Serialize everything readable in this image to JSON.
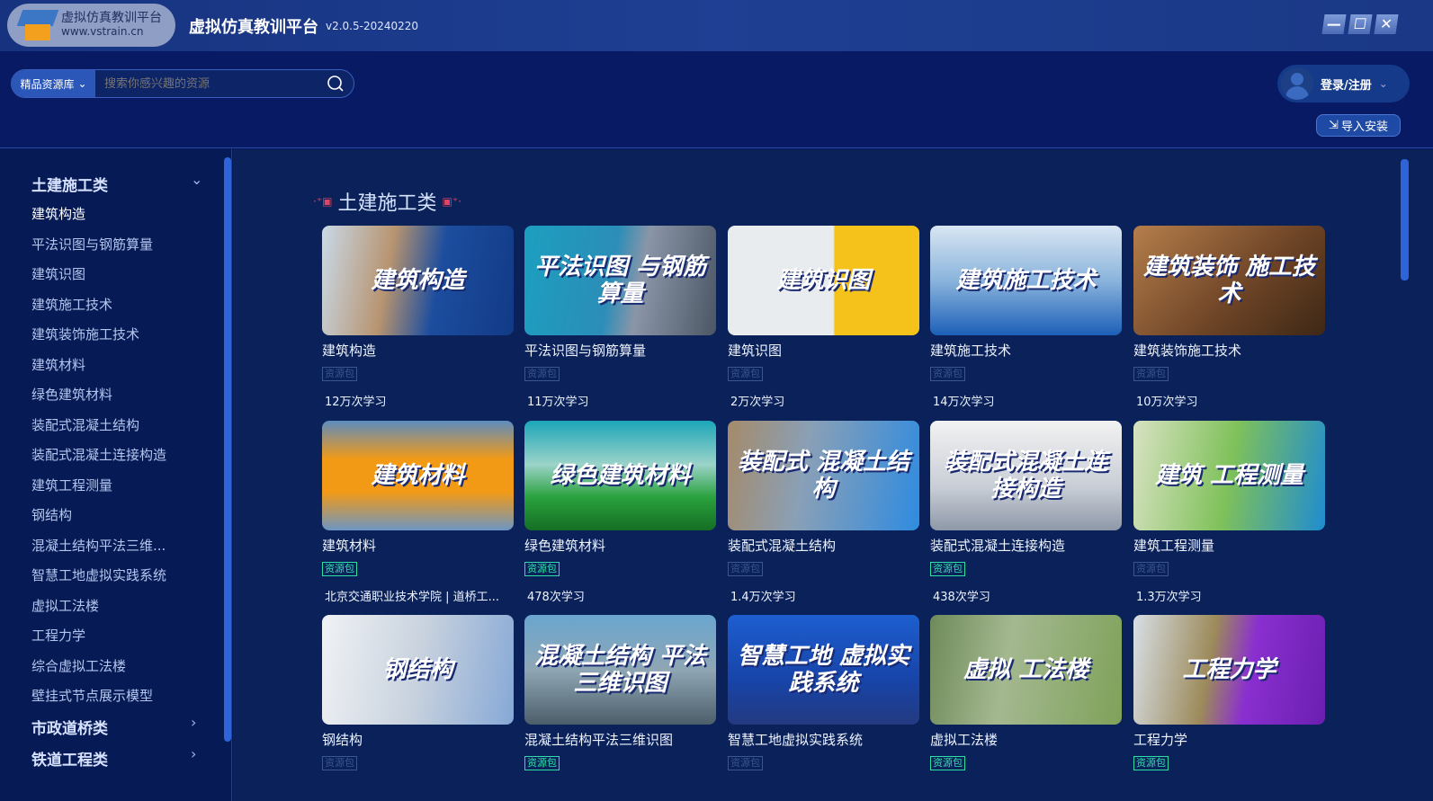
{
  "app": {
    "logo_text": "虚拟仿真教训平台",
    "logo_url": "www.vstrain.cn",
    "title": "虚拟仿真教训平台",
    "version": "v2.0.5-20240220"
  },
  "window": {
    "minimize": "—",
    "maximize": "☐",
    "close": "✕"
  },
  "search": {
    "scope": "精品资源库",
    "placeholder": "搜索你感兴趣的资源"
  },
  "user": {
    "login_label": "登录/注册",
    "import_label": "导入安装"
  },
  "sidebar": {
    "categories": [
      {
        "label": "土建施工类",
        "expanded": true
      },
      {
        "label": "市政道桥类"
      },
      {
        "label": "铁道工程类"
      }
    ],
    "items": [
      "建筑构造",
      "平法识图与钢筋算量",
      "建筑识图",
      "建筑施工技术",
      "建筑装饰施工技术",
      "建筑材料",
      "绿色建筑材料",
      "装配式混凝土结构",
      "装配式混凝土连接构造",
      "建筑工程测量",
      "钢结构",
      "混凝土结构平法三维...",
      "智慧工地虚拟实践系统",
      "虚拟工法楼",
      "工程力学",
      "综合虚拟工法楼",
      "壁挂式节点展示模型"
    ],
    "active_index": 0
  },
  "section": {
    "title": "土建施工类"
  },
  "cards": [
    {
      "name": "建筑构造",
      "thumb": "建筑构造",
      "badge": "资源包",
      "badge_active": false,
      "stat": "12万次学习",
      "bg": "linear-gradient(100deg,#c9d9e8,#b79470 35%,#1c4d9e 60%,#123a86)"
    },
    {
      "name": "平法识图与钢筋算量",
      "thumb": "平法识图 与钢筋算量",
      "badge": "资源包",
      "badge_active": false,
      "stat": "11万次学习",
      "bg": "linear-gradient(100deg,#1c9fc0,#2b8db8 45%,#8a96a8 60%,#4b5664)"
    },
    {
      "name": "建筑识图",
      "thumb": "建筑识图",
      "badge": "资源包",
      "badge_active": false,
      "stat": "2万次学习",
      "bg": "linear-gradient(90deg,#e9ecef 55%,#f5c21b 56%)"
    },
    {
      "name": "建筑施工技术",
      "thumb": "建筑施工技术",
      "badge": "资源包",
      "badge_active": false,
      "stat": "14万次学习",
      "bg": "linear-gradient(180deg,#d9e6f3,#8ab4dc 50%,#1d5fb8)"
    },
    {
      "name": "建筑装饰施工技术",
      "thumb": "建筑装饰 施工技术",
      "badge": "资源包",
      "badge_active": false,
      "stat": "10万次学习",
      "bg": "linear-gradient(135deg,#b57e4b,#6b4225 60%,#3d2816)"
    },
    {
      "name": "建筑材料",
      "thumb": "建筑材料",
      "badge": "资源包",
      "badge_active": true,
      "stat": "北京交通职业技术学院 | 道桥工...",
      "bg": "linear-gradient(180deg,#5d8cc0,#f29a16 35%,#f29a16 65%,#6c96c4)"
    },
    {
      "name": "绿色建筑材料",
      "thumb": "绿色建筑材料",
      "badge": "资源包",
      "badge_active": true,
      "stat": "478次学习",
      "bg": "linear-gradient(180deg,#1ca6b8,#9bd3c8 40%,#29a13d 70%,#156e24)"
    },
    {
      "name": "装配式混凝土结构",
      "thumb": "装配式 混凝土结构",
      "badge": "资源包",
      "badge_active": false,
      "stat": "1.4万次学习",
      "bg": "linear-gradient(100deg,#a58a6a,#8aa0b6 40%,#2f8be0)"
    },
    {
      "name": "装配式混凝土连接构造",
      "thumb": "装配式混凝土连接构造",
      "badge": "资源包",
      "badge_active": true,
      "stat": "438次学习",
      "bg": "linear-gradient(180deg,#f2f2f2,#c9ced6 60%,#8e98a8)"
    },
    {
      "name": "建筑工程测量",
      "thumb": "建筑 工程测量",
      "badge": "资源包",
      "badge_active": false,
      "stat": "1.3万次学习",
      "bg": "linear-gradient(100deg,#d8e2c2,#7fc15a 50%,#1f8cd0)"
    },
    {
      "name": "钢结构",
      "thumb": "钢结构",
      "badge": "资源包",
      "badge_active": false,
      "stat": "",
      "bg": "linear-gradient(100deg,#f0f2f5,#c8d2de 50%,#86a8d6)"
    },
    {
      "name": "混凝土结构平法三维识图",
      "thumb": "混凝土结构 平法三维识图",
      "badge": "资源包",
      "badge_active": true,
      "stat": "",
      "bg": "linear-gradient(180deg,#6aa6cf,#8fa6b4 50%,#4c5e6a)"
    },
    {
      "name": "智慧工地虚拟实践系统",
      "thumb": "智慧工地 虚拟实践系统",
      "badge": "资源包",
      "badge_active": false,
      "stat": "",
      "bg": "linear-gradient(180deg,#1d5ed0,#1744a8 60%,#233a80)"
    },
    {
      "name": "虚拟工法楼",
      "thumb": "虚拟 工法楼",
      "badge": "资源包",
      "badge_active": true,
      "stat": "",
      "bg": "linear-gradient(100deg,#6e8a5a,#a4b890 40%,#7fa25a)"
    },
    {
      "name": "工程力学",
      "thumb": "工程力学",
      "badge": "资源包",
      "badge_active": true,
      "stat": "",
      "bg": "linear-gradient(100deg,#d8dfe6,#9c8a5a 40%,#8a2fd0 60%,#6a1fb0)"
    }
  ]
}
